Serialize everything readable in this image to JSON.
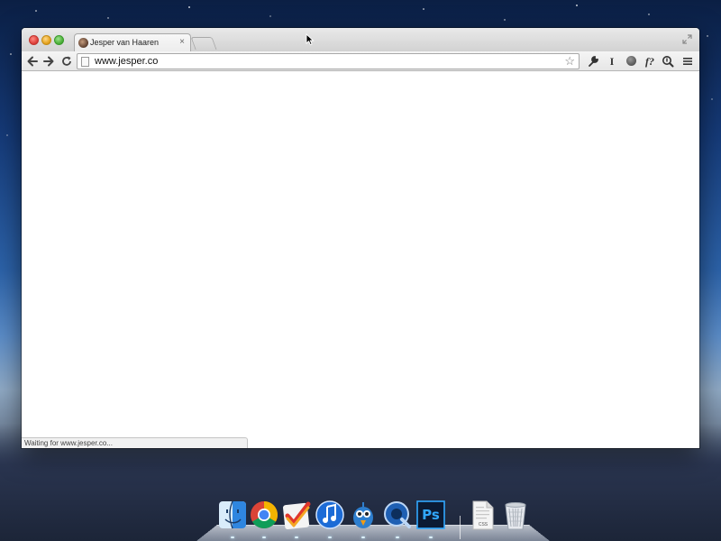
{
  "browser": {
    "tab": {
      "title": "Jesper van Haaren",
      "close_symbol": "×"
    },
    "address_bar": {
      "url": "www.jesper.co"
    },
    "status_text": "Waiting for www.jesper.co...",
    "extensions": {
      "ibeam_glyph": "I",
      "font_glyph": "f?"
    },
    "toolbar_icons": [
      "back-icon",
      "forward-icon",
      "reload-icon",
      "bookmark-star-icon",
      "wrench-icon",
      "ibeam-icon",
      "circle-extension-icon",
      "whatfont-icon",
      "magnifier-extension-icon",
      "menu-icon"
    ]
  },
  "dock": {
    "items": [
      "Finder",
      "Google Chrome",
      "Wunderlist",
      "iTunes",
      "Tweetbot",
      "QuickTime Player",
      "Photoshop",
      "CSS Document",
      "Trash"
    ],
    "photoshop_label": "Ps",
    "css_doc_label": "CSS"
  },
  "colors": {
    "photoshop_bg": "#0b1a33",
    "photoshop_accent": "#31a8ff",
    "window_chrome": "#e6e6e6"
  }
}
